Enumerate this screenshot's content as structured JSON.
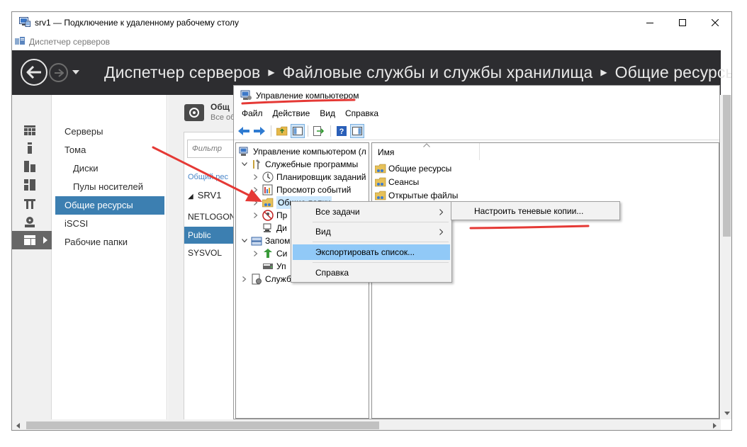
{
  "rdp_window": {
    "title": "srv1 — Подключение к удаленному рабочему столу"
  },
  "server_manager": {
    "title": "Диспетчер серверов",
    "breadcrumb": [
      "Диспетчер серверов",
      "Файловые службы и службы хранилища",
      "Общие ресурсы"
    ],
    "icon_strip": [
      "dashboard-icon",
      "local-server-icon",
      "all-servers-icon",
      "roles-icon",
      "tools-icon",
      "storage-icon",
      "file-services-icon"
    ],
    "nav": {
      "items": [
        {
          "label": "Серверы"
        },
        {
          "label": "Тома"
        },
        {
          "label": "Диски"
        },
        {
          "label": "Пулы носителей"
        },
        {
          "label": "Общие ресурсы"
        },
        {
          "label": "iSCSI"
        },
        {
          "label": "Рабочие папки"
        }
      ]
    },
    "shares": {
      "title": "Общ",
      "subtitle": "Все обо",
      "filter_placeholder": "Фильтр",
      "link": "Общий рес",
      "server": "SRV1",
      "rows": [
        "NETLOGON",
        "Public",
        "SYSVOL"
      ]
    }
  },
  "computer_management": {
    "title": "Управление компьютером",
    "menu": [
      "Файл",
      "Действие",
      "Вид",
      "Справка"
    ],
    "tree": {
      "root": "Управление компьютером (л",
      "system_tools": "Служебные программы",
      "items": [
        {
          "label": "Планировщик заданий"
        },
        {
          "label": "Просмотр событий"
        },
        {
          "label": "Общие папки"
        },
        {
          "label": "Пр"
        },
        {
          "label": "Ди"
        }
      ],
      "storage": "Запом",
      "storage_items": [
        {
          "label": "Си"
        },
        {
          "label": "Уп"
        }
      ],
      "services": "Служб"
    },
    "list": {
      "column": "Имя",
      "rows": [
        "Общие ресурсы",
        "Сеансы",
        "Открытые файлы"
      ]
    }
  },
  "context_menu": {
    "items": [
      {
        "label": "Все задачи",
        "submenu": true
      },
      {
        "label": "Вид",
        "submenu": true
      },
      {
        "label": "Экспортировать список...",
        "highlighted": true
      },
      {
        "label": "Справка"
      }
    ],
    "submenu_items": [
      "Настроить теневые копии..."
    ]
  },
  "colors": {
    "header_bg": "#2d2d30",
    "nav_active": "#3c7fb1",
    "menu_highlight": "#91c9f7",
    "annotation": "#e53935"
  }
}
